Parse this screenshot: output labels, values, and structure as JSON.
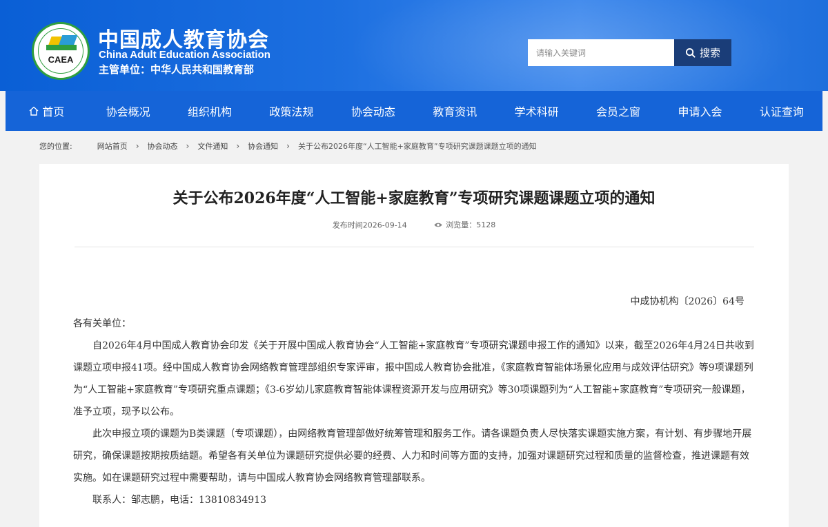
{
  "header": {
    "logo_text": "CAEA",
    "title": "中国成人教育协会",
    "title_en": "China Adult Education Association",
    "subtitle": "主管单位：中华人民共和国教育部"
  },
  "search": {
    "placeholder": "请输入关键词",
    "button_label": "搜索"
  },
  "nav": {
    "items": [
      {
        "label": "首页"
      },
      {
        "label": "协会概况"
      },
      {
        "label": "组织机构"
      },
      {
        "label": "政策法规"
      },
      {
        "label": "协会动态"
      },
      {
        "label": "教育资讯"
      },
      {
        "label": "学术科研"
      },
      {
        "label": "会员之窗"
      },
      {
        "label": "申请入会"
      },
      {
        "label": "认证查询"
      }
    ]
  },
  "breadcrumb": {
    "label": "您的位置:",
    "items": [
      "网站首页",
      "协会动态",
      "文件通知",
      "协会通知"
    ],
    "current": "关于公布2026年度“人工智能+家庭教育”专项研究课题课题立项的通知"
  },
  "article": {
    "title": "关于公布2026年度“人工智能+家庭教育”专项研究课题课题立项的通知",
    "publish_time": "发布时间2026-09-14",
    "views": "浏览量：5128",
    "doc_number": "中成协机构〔2026〕64号",
    "salutation": "各有关单位：",
    "paragraphs": [
      "自2026年4月中国成人教育协会印发《关于开展中国成人教育协会“人工智能+家庭教育”专项研究课题申报工作的通知》以来，截至2026年4月24日共收到课题立项申报41项。经中国成人教育协会网络教育管理部组织专家评审，报中国成人教育协会批准，《家庭教育智能体场景化应用与成效评估研究》等9项课题列为“人工智能+家庭教育”专项研究重点课题；《3-6岁幼儿家庭教育智能体课程资源开发与应用研究》等30项课题列为“人工智能+家庭教育”专项研究一般课题，准予立项，现予以公布。",
      "此次申报立项的课题为B类课题（专项课题），由网络教育管理部做好统筹管理和服务工作。请各课题负责人尽快落实课题实施方案，有计划、有步骤地开展研究，确保课题按期按质结题。希望各有关单位为课题研究提供必要的经费、人力和时间等方面的支持，加强对课题研究过程和质量的监督检查，推进课题有效实施。如在课题研究过程中需要帮助，请与中国成人教育协会网络教育管理部联系。",
      "联系人：邹志鹏，电话：13810834913"
    ]
  },
  "colors": {
    "header_blue": "#1c6fe0",
    "nav_blue": "#1564d8",
    "search_button": "#1a3d78"
  },
  "icons": {
    "home": "home-icon",
    "search": "search-icon",
    "views": "eye-icon",
    "breadcrumb_separator": "chevron-right-icon"
  }
}
